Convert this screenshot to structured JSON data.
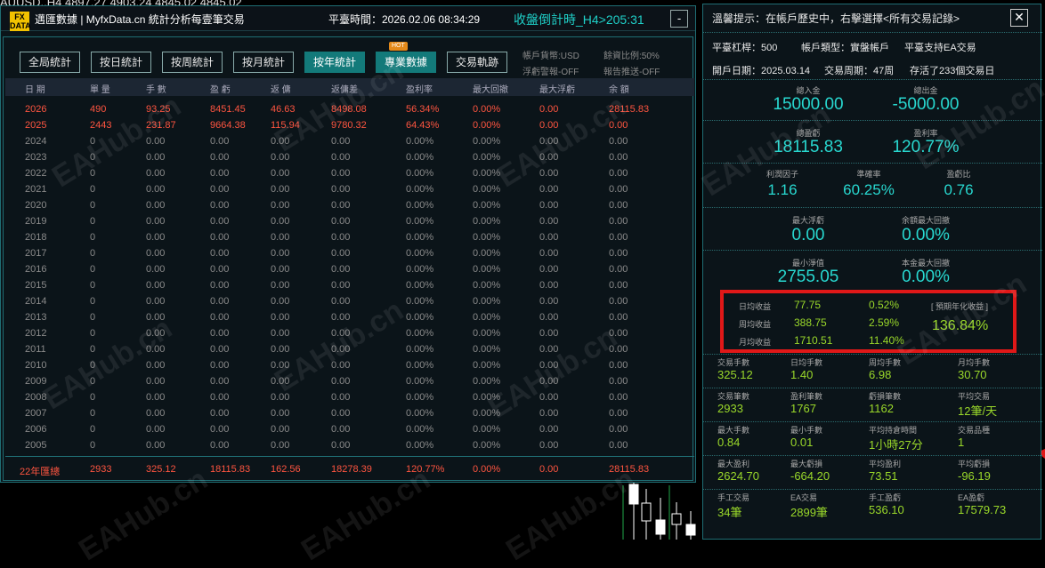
{
  "ticker": "AUUSD.,H4  4897.27 4903.24 4845.02 4845.02",
  "header": {
    "logo_text": "FX DATA",
    "title": "邁匯數據 | MyfxData.cn  統計分析每壹筆交易",
    "time": "平臺時間：2026.02.06 08:34:29",
    "countdown": "收盤倒計時_H4>205:31",
    "minimize": "-"
  },
  "tabs": [
    {
      "label": "全局統計"
    },
    {
      "label": "按日統計"
    },
    {
      "label": "按周統計"
    },
    {
      "label": "按月統計"
    },
    {
      "label": "按年統計",
      "active": true
    },
    {
      "label": "專業數據",
      "badge": "HOT"
    },
    {
      "label": "交易軌跡"
    }
  ],
  "options": {
    "currency": "帳戶貨幣:USD",
    "loss_alert": "浮虧警報-OFF",
    "margin_ratio": "餘資比例:50%",
    "report_push": "報告推送-OFF"
  },
  "table": {
    "headers": [
      "日 期",
      "單 量",
      "手 數",
      "盈 虧",
      "返 傭",
      "返傭差",
      "盈利率",
      "最大回撤",
      "最大浮虧",
      "余 額"
    ],
    "rows": [
      [
        "2026",
        "490",
        "93.25",
        "8451.45",
        "46.63",
        "8498.08",
        "56.34%",
        "0.00%",
        "0.00",
        "28115.83"
      ],
      [
        "2025",
        "2443",
        "231.87",
        "9664.38",
        "115.94",
        "9780.32",
        "64.43%",
        "0.00%",
        "0.00",
        "0.00"
      ],
      [
        "2024",
        "0",
        "0.00",
        "0.00",
        "0.00",
        "0.00",
        "0.00%",
        "0.00%",
        "0.00",
        "0.00"
      ],
      [
        "2023",
        "0",
        "0.00",
        "0.00",
        "0.00",
        "0.00",
        "0.00%",
        "0.00%",
        "0.00",
        "0.00"
      ],
      [
        "2022",
        "0",
        "0.00",
        "0.00",
        "0.00",
        "0.00",
        "0.00%",
        "0.00%",
        "0.00",
        "0.00"
      ],
      [
        "2021",
        "0",
        "0.00",
        "0.00",
        "0.00",
        "0.00",
        "0.00%",
        "0.00%",
        "0.00",
        "0.00"
      ],
      [
        "2020",
        "0",
        "0.00",
        "0.00",
        "0.00",
        "0.00",
        "0.00%",
        "0.00%",
        "0.00",
        "0.00"
      ],
      [
        "2019",
        "0",
        "0.00",
        "0.00",
        "0.00",
        "0.00",
        "0.00%",
        "0.00%",
        "0.00",
        "0.00"
      ],
      [
        "2018",
        "0",
        "0.00",
        "0.00",
        "0.00",
        "0.00",
        "0.00%",
        "0.00%",
        "0.00",
        "0.00"
      ],
      [
        "2017",
        "0",
        "0.00",
        "0.00",
        "0.00",
        "0.00",
        "0.00%",
        "0.00%",
        "0.00",
        "0.00"
      ],
      [
        "2016",
        "0",
        "0.00",
        "0.00",
        "0.00",
        "0.00",
        "0.00%",
        "0.00%",
        "0.00",
        "0.00"
      ],
      [
        "2015",
        "0",
        "0.00",
        "0.00",
        "0.00",
        "0.00",
        "0.00%",
        "0.00%",
        "0.00",
        "0.00"
      ],
      [
        "2014",
        "0",
        "0.00",
        "0.00",
        "0.00",
        "0.00",
        "0.00%",
        "0.00%",
        "0.00",
        "0.00"
      ],
      [
        "2013",
        "0",
        "0.00",
        "0.00",
        "0.00",
        "0.00",
        "0.00%",
        "0.00%",
        "0.00",
        "0.00"
      ],
      [
        "2012",
        "0",
        "0.00",
        "0.00",
        "0.00",
        "0.00",
        "0.00%",
        "0.00%",
        "0.00",
        "0.00"
      ],
      [
        "2011",
        "0",
        "0.00",
        "0.00",
        "0.00",
        "0.00",
        "0.00%",
        "0.00%",
        "0.00",
        "0.00"
      ],
      [
        "2010",
        "0",
        "0.00",
        "0.00",
        "0.00",
        "0.00",
        "0.00%",
        "0.00%",
        "0.00",
        "0.00"
      ],
      [
        "2009",
        "0",
        "0.00",
        "0.00",
        "0.00",
        "0.00",
        "0.00%",
        "0.00%",
        "0.00",
        "0.00"
      ],
      [
        "2008",
        "0",
        "0.00",
        "0.00",
        "0.00",
        "0.00",
        "0.00%",
        "0.00%",
        "0.00",
        "0.00"
      ],
      [
        "2007",
        "0",
        "0.00",
        "0.00",
        "0.00",
        "0.00",
        "0.00%",
        "0.00%",
        "0.00",
        "0.00"
      ],
      [
        "2006",
        "0",
        "0.00",
        "0.00",
        "0.00",
        "0.00",
        "0.00%",
        "0.00%",
        "0.00",
        "0.00"
      ],
      [
        "2005",
        "0",
        "0.00",
        "0.00",
        "0.00",
        "0.00",
        "0.00%",
        "0.00%",
        "0.00",
        "0.00"
      ]
    ],
    "summary": [
      "22年匯總",
      "2933",
      "325.12",
      "18115.83",
      "162.56",
      "18278.39",
      "120.77%",
      "0.00%",
      "0.00",
      "28115.83"
    ]
  },
  "right": {
    "hint": "溫馨提示：在帳戶歷史中，右擊選擇<所有交易記錄>",
    "close": "✕",
    "leverage": "平臺杠桿：500",
    "account_type": "帳戶類型：實盤帳戶",
    "ea_support": "平臺支持EA交易",
    "open_date": "開戶日期：2025.03.14",
    "trade_period": "交易周期：47周",
    "survived": "存活了233個交易日",
    "total_deposit_label": "總入金",
    "total_deposit": "15000.00",
    "total_withdraw_label": "總出金",
    "total_withdraw": "-5000.00",
    "total_profit_label": "總盈虧",
    "total_profit": "18115.83",
    "profit_rate_label": "盈利率",
    "profit_rate": "120.77%",
    "profit_factor_label": "利潤因子",
    "profit_factor": "1.16",
    "accuracy_label": "準確率",
    "accuracy": "60.25%",
    "pl_ratio_label": "盈虧比",
    "pl_ratio": "0.76",
    "max_float_loss_label": "最大浮虧",
    "max_float_loss": "0.00",
    "balance_dd_label": "余額最大回撤",
    "balance_dd": "0.00%",
    "min_equity_label": "最小淨值",
    "min_equity": "2755.05",
    "principal_dd_label": "本金最大回撤",
    "principal_dd": "0.00%",
    "returns": {
      "daily_label": "日均收益",
      "daily_val": "77.75",
      "daily_pct": "0.52%",
      "weekly_label": "周均收益",
      "weekly_val": "388.75",
      "weekly_pct": "2.59%",
      "monthly_label": "月均收益",
      "monthly_val": "1710.51",
      "monthly_pct": "11.40%",
      "annual_label": "[ 預期年化收益 ]",
      "annual_val": "136.84%"
    },
    "grid": [
      [
        {
          "label": "交易手數",
          "value": "325.12"
        },
        {
          "label": "日均手數",
          "value": "1.40"
        },
        {
          "label": "周均手數",
          "value": "6.98"
        },
        {
          "label": "月均手數",
          "value": "30.70"
        }
      ],
      [
        {
          "label": "交易筆數",
          "value": "2933"
        },
        {
          "label": "盈利筆數",
          "value": "1767"
        },
        {
          "label": "虧損筆數",
          "value": "1162"
        },
        {
          "label": "平均交易",
          "value": "12筆/天"
        }
      ],
      [
        {
          "label": "最大手數",
          "value": "0.84"
        },
        {
          "label": "最小手數",
          "value": "0.01"
        },
        {
          "label": "平均持倉時間",
          "value": "1小時27分"
        },
        {
          "label": "交易品種",
          "value": "1"
        }
      ],
      [
        {
          "label": "最大盈利",
          "value": "2624.70"
        },
        {
          "label": "最大虧損",
          "value": "-664.20"
        },
        {
          "label": "平均盈利",
          "value": "73.51"
        },
        {
          "label": "平均虧損",
          "value": "-96.19"
        }
      ],
      [
        {
          "label": "手工交易",
          "value": "34筆"
        },
        {
          "label": "EA交易",
          "value": "2899筆"
        },
        {
          "label": "手工盈虧",
          "value": "536.10"
        },
        {
          "label": "EA盈虧",
          "value": "17579.73"
        }
      ]
    ]
  },
  "watermark": "EAHub.cn",
  "colors": {
    "teal": "#28d8d0",
    "green": "#9ad82a",
    "red_text": "#ff5540",
    "alert_box": "#e01818"
  }
}
